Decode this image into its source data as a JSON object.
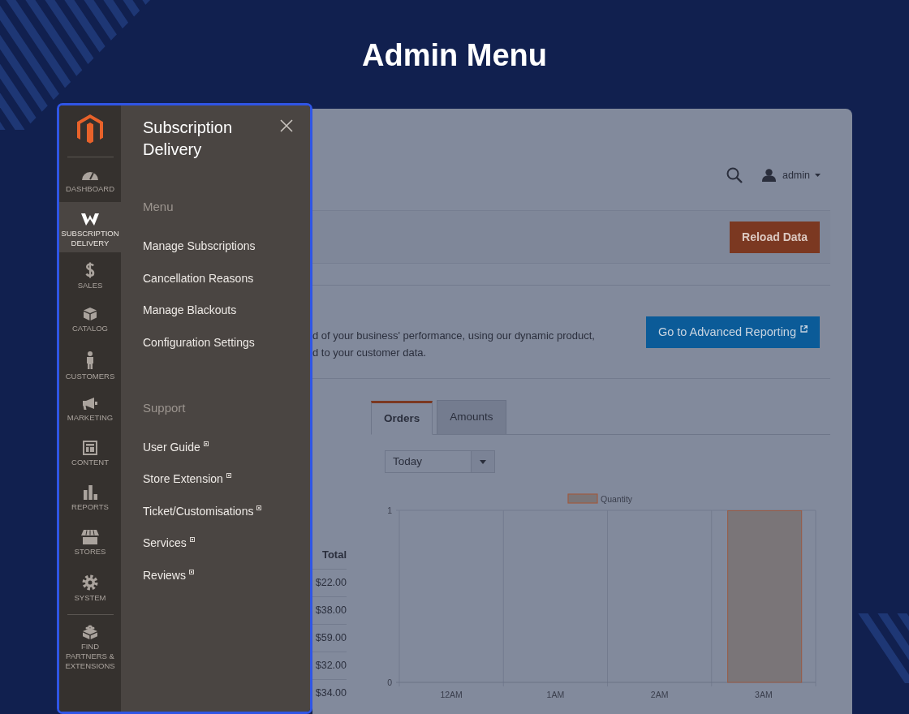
{
  "page": {
    "title": "Admin Menu"
  },
  "sidebar": {
    "items": [
      {
        "label": "DASHBOARD",
        "selected": false
      },
      {
        "label": "SUBSCRIPTION DELIVERY",
        "selected": true
      },
      {
        "label": "SALES",
        "selected": false
      },
      {
        "label": "CATALOG",
        "selected": false
      },
      {
        "label": "CUSTOMERS",
        "selected": false
      },
      {
        "label": "MARKETING",
        "selected": false
      },
      {
        "label": "CONTENT",
        "selected": false
      },
      {
        "label": "REPORTS",
        "selected": false
      },
      {
        "label": "STORES",
        "selected": false
      },
      {
        "label": "SYSTEM",
        "selected": false
      },
      {
        "label": "FIND PARTNERS & EXTENSIONS",
        "selected": false
      }
    ]
  },
  "flyout": {
    "title": "Subscription Delivery",
    "sections": [
      {
        "heading": "Menu",
        "items": [
          {
            "label": "Manage Subscriptions",
            "external": false
          },
          {
            "label": "Cancellation Reasons",
            "external": false
          },
          {
            "label": "Manage Blackouts",
            "external": false
          },
          {
            "label": "Configuration Settings",
            "external": false
          }
        ]
      },
      {
        "heading": "Support",
        "items": [
          {
            "label": "User Guide",
            "external": true
          },
          {
            "label": "Store Extension",
            "external": true
          },
          {
            "label": "Ticket/Customisations",
            "external": true
          },
          {
            "label": "Services",
            "external": true
          },
          {
            "label": "Reviews",
            "external": true
          }
        ]
      }
    ]
  },
  "dashboard": {
    "user_menu": {
      "label": "admin"
    },
    "reload_button": "Reload Data",
    "description_lines": [
      "d of your business' performance, using our dynamic product,",
      "d to your customer data."
    ],
    "reporting_button": "Go to Advanced Reporting",
    "table": {
      "columns": [
        "Total"
      ],
      "rows": [
        [
          "$22.00"
        ],
        [
          "$38.00"
        ],
        [
          "$59.00"
        ],
        [
          "$32.00"
        ],
        [
          "$34.00"
        ]
      ]
    },
    "tabs": [
      {
        "label": "Orders",
        "selected": true
      },
      {
        "label": "Amounts",
        "selected": false
      }
    ],
    "period_select": {
      "value": "Today"
    },
    "chart": {
      "chart_data": {
        "type": "bar",
        "categories": [
          "12AM",
          "1AM",
          "2AM",
          "3AM"
        ],
        "series": [
          {
            "name": "Quantity",
            "color": "#7a7578",
            "values": [
              0,
              0,
              0,
              1
            ]
          }
        ],
        "ylim": [
          0,
          1
        ],
        "yticks": [
          0,
          1
        ]
      }
    }
  }
}
